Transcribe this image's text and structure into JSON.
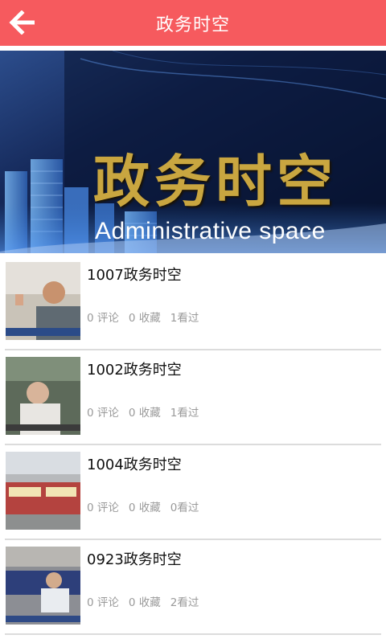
{
  "header": {
    "title": "政务时空",
    "back_icon": "back-arrow-icon"
  },
  "banner": {
    "title_cn": "政务时空",
    "title_en": "Administrative space"
  },
  "items": [
    {
      "title": "1007政务时空",
      "comments": "0 评论",
      "favorites": "0 收藏",
      "views": "1看过"
    },
    {
      "title": "1002政务时空",
      "comments": "0 评论",
      "favorites": "0 收藏",
      "views": "1看过"
    },
    {
      "title": "1004政务时空",
      "comments": "0 评论",
      "favorites": "0 收藏",
      "views": "0看过"
    },
    {
      "title": "0923政务时空",
      "comments": "0 评论",
      "favorites": "0 收藏",
      "views": "2看过"
    }
  ],
  "colors": {
    "header_bg": "#f65a5e",
    "banner_gold": "#c9a640",
    "meta_text": "#9a9a9a"
  }
}
